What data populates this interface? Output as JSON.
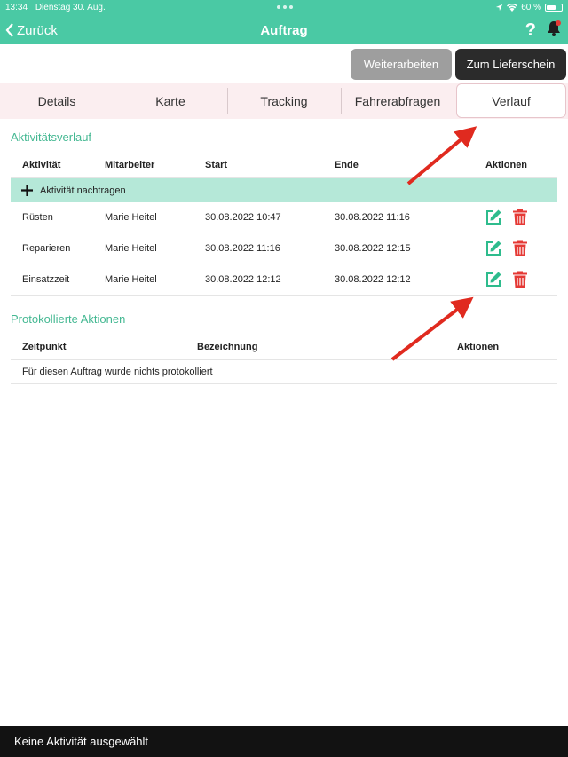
{
  "status_bar": {
    "time": "13:34",
    "date": "Dienstag 30. Aug.",
    "battery": "60 %",
    "battery_level": 0.6
  },
  "nav": {
    "back_label": "Zurück",
    "title": "Auftrag"
  },
  "actions": {
    "continue_label": "Weiterarbeiten",
    "delivery_note_label": "Zum Lieferschein"
  },
  "tabs": [
    {
      "label": "Details"
    },
    {
      "label": "Karte"
    },
    {
      "label": "Tracking"
    },
    {
      "label": "Fahrerabfragen"
    },
    {
      "label": "Verlauf"
    }
  ],
  "activity_section": {
    "title": "Aktivitätsverlauf",
    "columns": [
      "Aktivität",
      "Mitarbeiter",
      "Start",
      "Ende",
      "Aktionen"
    ],
    "add_label": "Aktivität nachtragen",
    "rows": [
      {
        "activity": "Rüsten",
        "employee": "Marie Heitel",
        "start": "30.08.2022 10:47",
        "end": "30.08.2022 11:16"
      },
      {
        "activity": "Reparieren",
        "employee": "Marie Heitel",
        "start": "30.08.2022 11:16",
        "end": "30.08.2022 12:15"
      },
      {
        "activity": "Einsatzzeit",
        "employee": "Marie Heitel",
        "start": "30.08.2022 12:12",
        "end": "30.08.2022 12:12"
      }
    ]
  },
  "log_section": {
    "title": "Protokollierte Aktionen",
    "columns": [
      "Zeitpunkt",
      "Bezeichnung",
      "Aktionen"
    ],
    "empty_text": "Für diesen Auftrag wurde nichts protokolliert"
  },
  "footer": {
    "text": "Keine Aktivität ausgewählt"
  },
  "colors": {
    "accent": "#4ac9a4",
    "danger": "#e53935",
    "annotation": "#e02a1f"
  },
  "icons": {
    "edit": "edit-icon",
    "delete": "trash-icon",
    "add": "plus-icon"
  }
}
